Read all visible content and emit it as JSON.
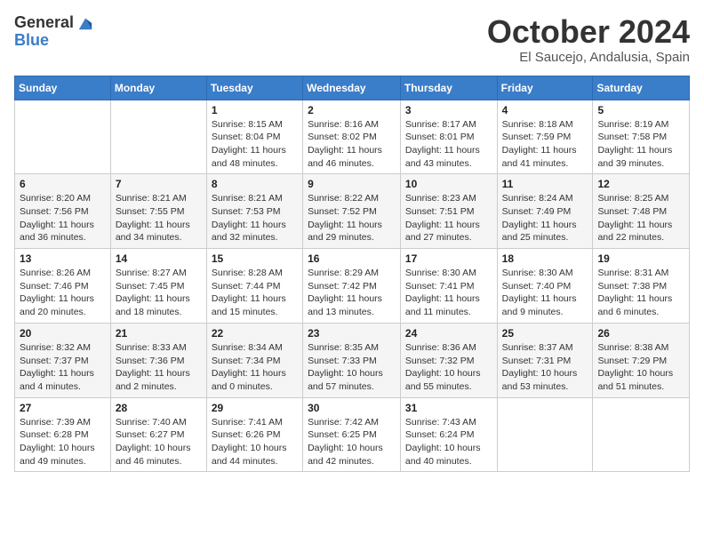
{
  "header": {
    "logo_general": "General",
    "logo_blue": "Blue",
    "month": "October 2024",
    "location": "El Saucejo, Andalusia, Spain"
  },
  "days_of_week": [
    "Sunday",
    "Monday",
    "Tuesday",
    "Wednesday",
    "Thursday",
    "Friday",
    "Saturday"
  ],
  "weeks": [
    [
      {
        "day": "",
        "content": ""
      },
      {
        "day": "",
        "content": ""
      },
      {
        "day": "1",
        "content": "Sunrise: 8:15 AM\nSunset: 8:04 PM\nDaylight: 11 hours and 48 minutes."
      },
      {
        "day": "2",
        "content": "Sunrise: 8:16 AM\nSunset: 8:02 PM\nDaylight: 11 hours and 46 minutes."
      },
      {
        "day": "3",
        "content": "Sunrise: 8:17 AM\nSunset: 8:01 PM\nDaylight: 11 hours and 43 minutes."
      },
      {
        "day": "4",
        "content": "Sunrise: 8:18 AM\nSunset: 7:59 PM\nDaylight: 11 hours and 41 minutes."
      },
      {
        "day": "5",
        "content": "Sunrise: 8:19 AM\nSunset: 7:58 PM\nDaylight: 11 hours and 39 minutes."
      }
    ],
    [
      {
        "day": "6",
        "content": "Sunrise: 8:20 AM\nSunset: 7:56 PM\nDaylight: 11 hours and 36 minutes."
      },
      {
        "day": "7",
        "content": "Sunrise: 8:21 AM\nSunset: 7:55 PM\nDaylight: 11 hours and 34 minutes."
      },
      {
        "day": "8",
        "content": "Sunrise: 8:21 AM\nSunset: 7:53 PM\nDaylight: 11 hours and 32 minutes."
      },
      {
        "day": "9",
        "content": "Sunrise: 8:22 AM\nSunset: 7:52 PM\nDaylight: 11 hours and 29 minutes."
      },
      {
        "day": "10",
        "content": "Sunrise: 8:23 AM\nSunset: 7:51 PM\nDaylight: 11 hours and 27 minutes."
      },
      {
        "day": "11",
        "content": "Sunrise: 8:24 AM\nSunset: 7:49 PM\nDaylight: 11 hours and 25 minutes."
      },
      {
        "day": "12",
        "content": "Sunrise: 8:25 AM\nSunset: 7:48 PM\nDaylight: 11 hours and 22 minutes."
      }
    ],
    [
      {
        "day": "13",
        "content": "Sunrise: 8:26 AM\nSunset: 7:46 PM\nDaylight: 11 hours and 20 minutes."
      },
      {
        "day": "14",
        "content": "Sunrise: 8:27 AM\nSunset: 7:45 PM\nDaylight: 11 hours and 18 minutes."
      },
      {
        "day": "15",
        "content": "Sunrise: 8:28 AM\nSunset: 7:44 PM\nDaylight: 11 hours and 15 minutes."
      },
      {
        "day": "16",
        "content": "Sunrise: 8:29 AM\nSunset: 7:42 PM\nDaylight: 11 hours and 13 minutes."
      },
      {
        "day": "17",
        "content": "Sunrise: 8:30 AM\nSunset: 7:41 PM\nDaylight: 11 hours and 11 minutes."
      },
      {
        "day": "18",
        "content": "Sunrise: 8:30 AM\nSunset: 7:40 PM\nDaylight: 11 hours and 9 minutes."
      },
      {
        "day": "19",
        "content": "Sunrise: 8:31 AM\nSunset: 7:38 PM\nDaylight: 11 hours and 6 minutes."
      }
    ],
    [
      {
        "day": "20",
        "content": "Sunrise: 8:32 AM\nSunset: 7:37 PM\nDaylight: 11 hours and 4 minutes."
      },
      {
        "day": "21",
        "content": "Sunrise: 8:33 AM\nSunset: 7:36 PM\nDaylight: 11 hours and 2 minutes."
      },
      {
        "day": "22",
        "content": "Sunrise: 8:34 AM\nSunset: 7:34 PM\nDaylight: 11 hours and 0 minutes."
      },
      {
        "day": "23",
        "content": "Sunrise: 8:35 AM\nSunset: 7:33 PM\nDaylight: 10 hours and 57 minutes."
      },
      {
        "day": "24",
        "content": "Sunrise: 8:36 AM\nSunset: 7:32 PM\nDaylight: 10 hours and 55 minutes."
      },
      {
        "day": "25",
        "content": "Sunrise: 8:37 AM\nSunset: 7:31 PM\nDaylight: 10 hours and 53 minutes."
      },
      {
        "day": "26",
        "content": "Sunrise: 8:38 AM\nSunset: 7:29 PM\nDaylight: 10 hours and 51 minutes."
      }
    ],
    [
      {
        "day": "27",
        "content": "Sunrise: 7:39 AM\nSunset: 6:28 PM\nDaylight: 10 hours and 49 minutes."
      },
      {
        "day": "28",
        "content": "Sunrise: 7:40 AM\nSunset: 6:27 PM\nDaylight: 10 hours and 46 minutes."
      },
      {
        "day": "29",
        "content": "Sunrise: 7:41 AM\nSunset: 6:26 PM\nDaylight: 10 hours and 44 minutes."
      },
      {
        "day": "30",
        "content": "Sunrise: 7:42 AM\nSunset: 6:25 PM\nDaylight: 10 hours and 42 minutes."
      },
      {
        "day": "31",
        "content": "Sunrise: 7:43 AM\nSunset: 6:24 PM\nDaylight: 10 hours and 40 minutes."
      },
      {
        "day": "",
        "content": ""
      },
      {
        "day": "",
        "content": ""
      }
    ]
  ]
}
